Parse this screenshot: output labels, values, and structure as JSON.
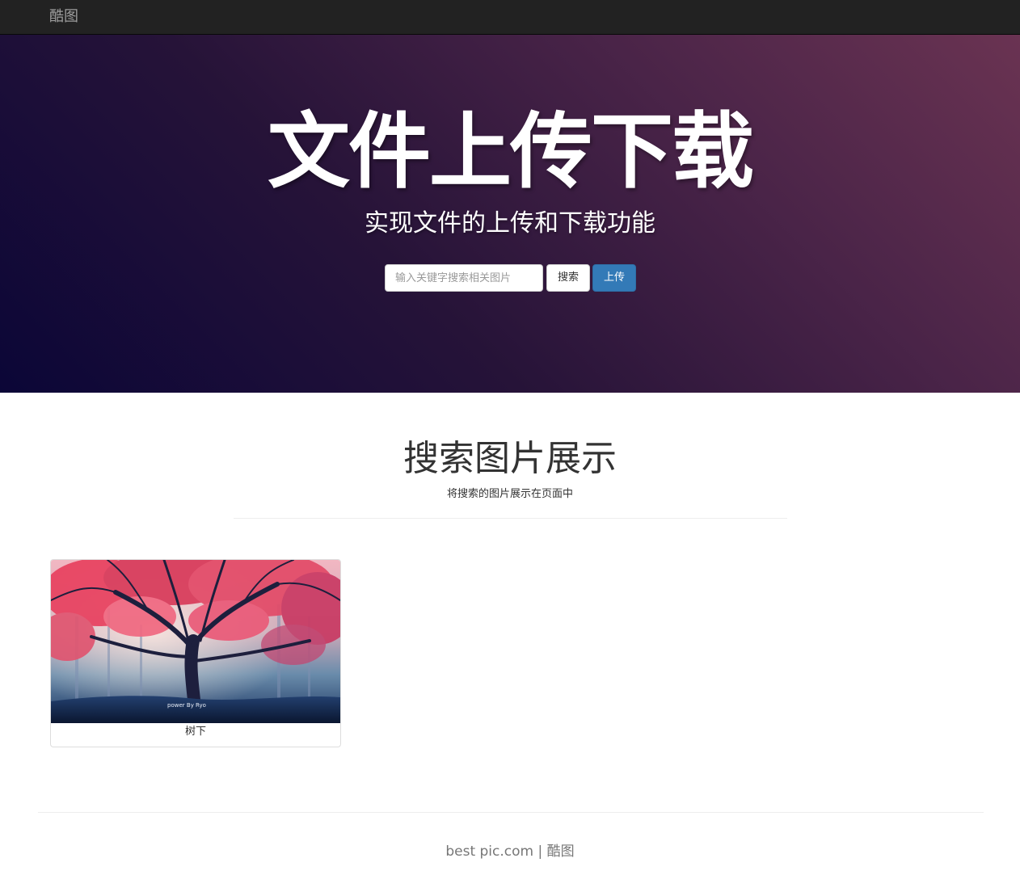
{
  "navbar": {
    "brand": "酷图"
  },
  "hero": {
    "title": "文件上传下载",
    "subtitle": "实现文件的上传和下载功能",
    "search_placeholder": "输入关键字搜索相关图片",
    "search_value": "",
    "search_button": "搜索",
    "upload_button": "上传"
  },
  "gallery": {
    "title": "搜索图片展示",
    "subtitle": "将搜索的图片展示在页面中",
    "items": [
      {
        "caption": "树下",
        "watermark": "power By Ryo"
      }
    ]
  },
  "footer": {
    "text": "best pic.com | 酷图"
  },
  "colors": {
    "navbar_bg": "#222222",
    "hero_gradient_start": "#0b0637",
    "hero_gradient_end": "#6a3352",
    "primary_button": "#337ab7"
  }
}
